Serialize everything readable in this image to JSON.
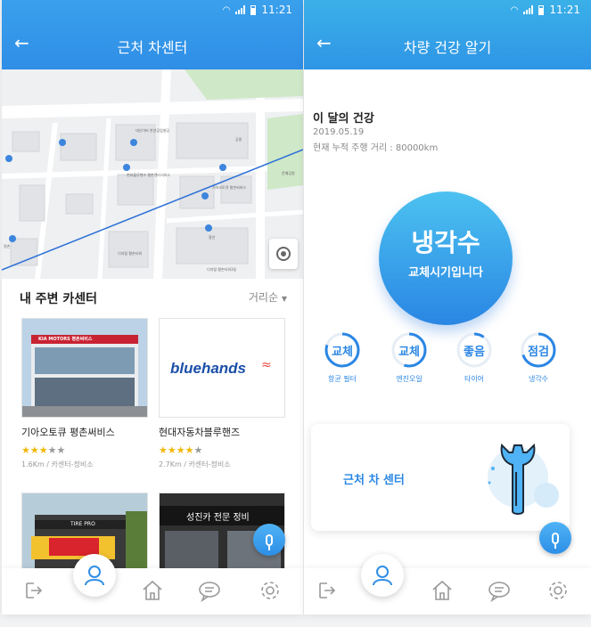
{
  "status": {
    "time": "11:21"
  },
  "left": {
    "title": "근처 차센터",
    "map": {
      "labels": [
        "대신아버 한양공업빌딩",
        "현대블루핸즈 평촌렌터서비스",
        "기아오토큐 평촌써비스",
        "디지털 평촌타워",
        "디지털 평촌타워3동",
        "공원",
        "정촌",
        "흥안",
        "문예공원"
      ],
      "street": "평촌대로"
    },
    "section_title": "내 주변 카센터",
    "sort_label": "거리순",
    "cards": [
      {
        "name": "기아오토큐 평촌써비스",
        "rating": 3,
        "meta": "1.6Km / 카센터-정비소",
        "sign": "KIA MOTORS 평촌써비스"
      },
      {
        "name": "현대자동차블루핸즈",
        "rating": 4,
        "meta": "2.7Km / 카센터-정비소",
        "logo": "bluehands"
      },
      {
        "sign": "TIRE PRO"
      },
      {
        "sign": "성진카 전문 정비"
      }
    ]
  },
  "right": {
    "title": "차량 건강 알기",
    "health": {
      "heading": "이 달의 건강",
      "date": "2019.05.19",
      "mileage": "현재 누적 주행 거리 : 80000km"
    },
    "status_circle": {
      "main": "냉각수",
      "sub": "교체시기입니다"
    },
    "gauges": [
      {
        "value": "교체",
        "label": "항균 필터",
        "level": 0.8,
        "color": "#2a86e4"
      },
      {
        "value": "교체",
        "label": "엔진오일",
        "level": 0.55,
        "color": "#2a86e4"
      },
      {
        "value": "좋음",
        "label": "타이어",
        "level": 0.1,
        "color": "#2a86e4"
      },
      {
        "value": "점검",
        "label": "냉각수",
        "level": 0.7,
        "color": "#2a86e4"
      }
    ],
    "center_card_label": "근처 차 센터"
  },
  "colors": {
    "primary": "#2f8ee6",
    "star": "#f2b705"
  }
}
